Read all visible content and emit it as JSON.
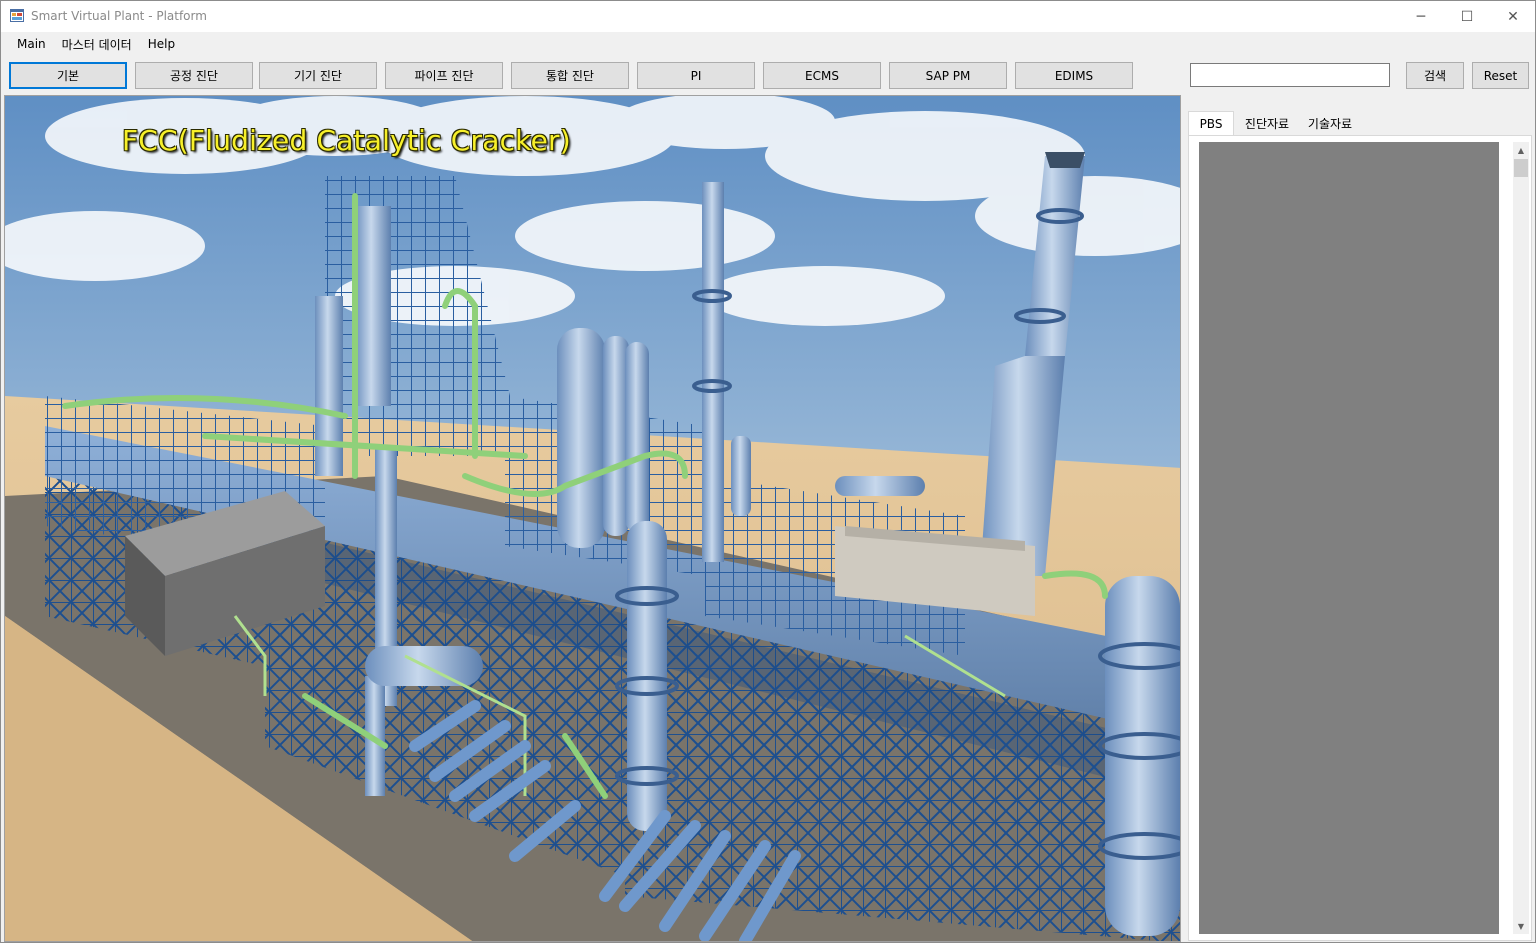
{
  "window": {
    "title": "Smart Virtual Plant - Platform",
    "controls": {
      "minimize": "─",
      "maximize": "☐",
      "close": "✕"
    }
  },
  "menu": [
    "Main",
    "마스터 데이터",
    "Help"
  ],
  "toolbar": {
    "buttons": [
      "기본",
      "공정 진단",
      "기기 진단",
      "파이프 진단",
      "통합 진단",
      "PI",
      "ECMS",
      "SAP PM",
      "EDIMS"
    ],
    "active_index": 0
  },
  "search": {
    "value": "",
    "button_label": "검색",
    "reset_label": "Reset"
  },
  "viewport": {
    "scene_title": "FCC(Fludized Catalytic Cracker)"
  },
  "side_panel": {
    "tabs": [
      "PBS",
      "진단자료",
      "기술자료"
    ],
    "selected_tab": 0
  },
  "colors": {
    "accent": "#0078d7",
    "sky": "#7ea8d0",
    "ground": "#e4c69a",
    "structure_blue": "#1f4e8c",
    "pipe_green": "#8fd07a",
    "vessel": "#9ab6d8",
    "tree_background": "#808080"
  }
}
